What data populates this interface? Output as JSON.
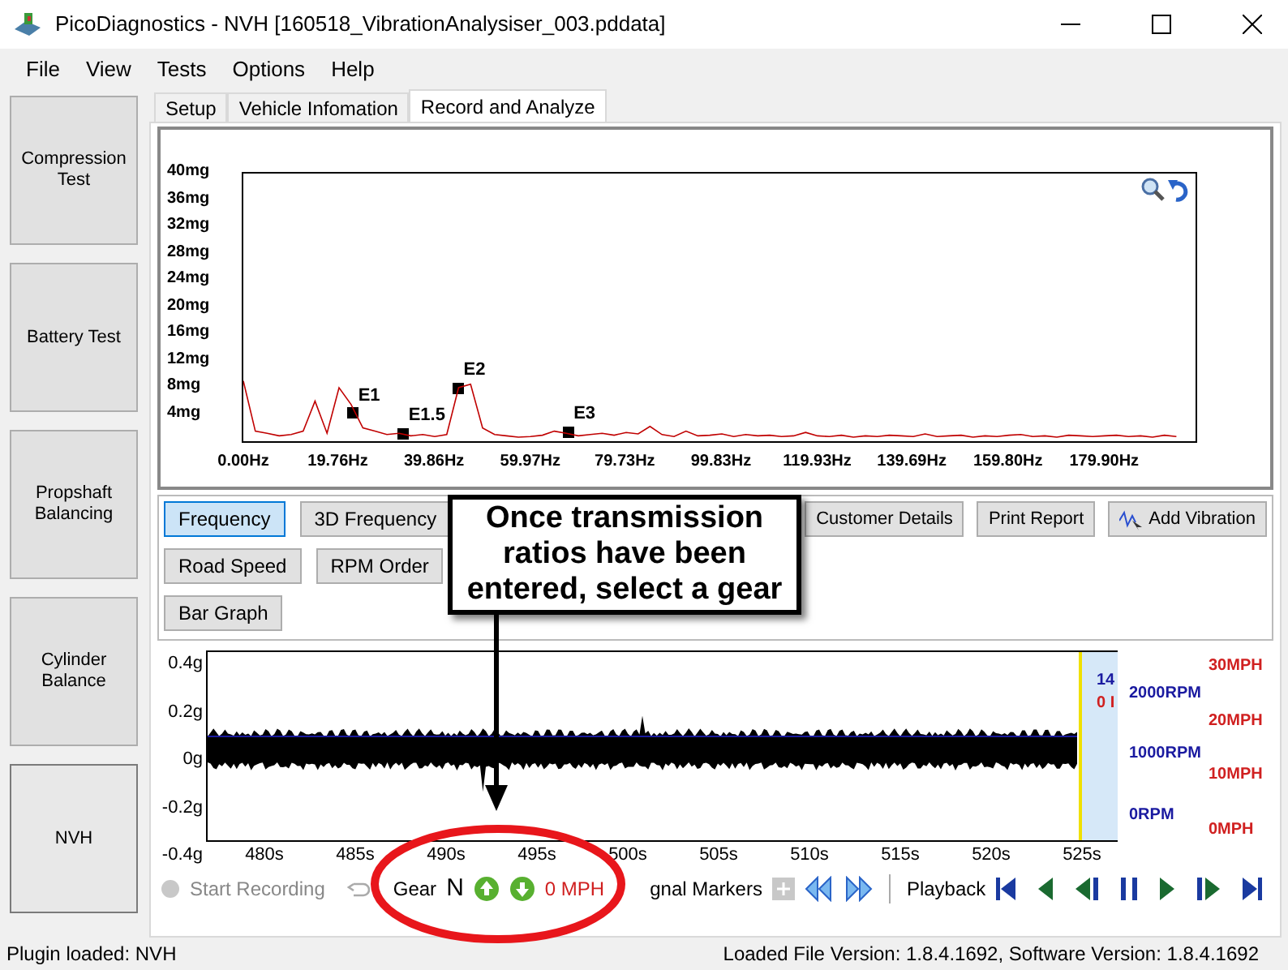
{
  "window": {
    "title": "PicoDiagnostics - NVH [160518_VibrationAnalysiser_003.pddata]"
  },
  "menu": [
    "File",
    "View",
    "Tests",
    "Options",
    "Help"
  ],
  "sidebar": [
    {
      "label": "Compression Test",
      "selected": false
    },
    {
      "label": "Battery Test",
      "selected": false
    },
    {
      "label": "Propshaft Balancing",
      "selected": false
    },
    {
      "label": "Cylinder Balance",
      "selected": false
    },
    {
      "label": "NVH",
      "selected": true
    }
  ],
  "tabs": [
    {
      "label": "Setup",
      "selected": false
    },
    {
      "label": "Vehicle Infomation",
      "selected": false
    },
    {
      "label": "Record and Analyze",
      "selected": true
    }
  ],
  "spectrum": {
    "chart_data": {
      "type": "line",
      "xlim": [
        0,
        199
      ],
      "ylim": [
        0,
        40
      ],
      "yticks": [
        {
          "value": 40,
          "label": "40mg"
        },
        {
          "value": 36,
          "label": "36mg"
        },
        {
          "value": 32,
          "label": "32mg"
        },
        {
          "value": 28,
          "label": "28mg"
        },
        {
          "value": 24,
          "label": "24mg"
        },
        {
          "value": 20,
          "label": "20mg"
        },
        {
          "value": 16,
          "label": "16mg"
        },
        {
          "value": 12,
          "label": "12mg"
        },
        {
          "value": 8,
          "label": "8mg"
        },
        {
          "value": 4,
          "label": "4mg"
        }
      ],
      "xticks": [
        {
          "value": 0,
          "label": "0.00Hz"
        },
        {
          "value": 19.76,
          "label": "19.76Hz"
        },
        {
          "value": 39.86,
          "label": "39.86Hz"
        },
        {
          "value": 59.97,
          "label": "59.97Hz"
        },
        {
          "value": 79.73,
          "label": "79.73Hz"
        },
        {
          "value": 99.83,
          "label": "99.83Hz"
        },
        {
          "value": 119.93,
          "label": "119.93Hz"
        },
        {
          "value": 139.69,
          "label": "139.69Hz"
        },
        {
          "value": 159.8,
          "label": "159.80Hz"
        },
        {
          "value": 179.9,
          "label": "179.90Hz"
        }
      ],
      "x": [
        0,
        2.5,
        5,
        7.5,
        10,
        12.5,
        15,
        17.5,
        20,
        22.5,
        25,
        27.5,
        30,
        32.5,
        35,
        37.5,
        40,
        42.5,
        45,
        47.5,
        50,
        52.5,
        55,
        57.5,
        60,
        62.5,
        65,
        67.5,
        70,
        72.5,
        75,
        77.5,
        80,
        82.5,
        85,
        87.5,
        90,
        92.5,
        95,
        97.5,
        100,
        102.5,
        105,
        107.5,
        110,
        112.5,
        115,
        117.5,
        120,
        122.5,
        125,
        127.5,
        130,
        132.5,
        135,
        137.5,
        140,
        142.5,
        145,
        147.5,
        150,
        152.5,
        155,
        157.5,
        160,
        162.5,
        165,
        167.5,
        170,
        172.5,
        175,
        177.5,
        180,
        182.5,
        185,
        187.5,
        190,
        192.5,
        195
      ],
      "series": [
        {
          "color": "#c00000",
          "values": [
            9,
            1.5,
            1.2,
            0.8,
            1,
            1.5,
            6,
            1.2,
            8,
            5.5,
            2,
            1.5,
            1,
            1.2,
            0.8,
            1,
            0.7,
            1,
            8,
            8.5,
            2,
            1,
            0.8,
            0.6,
            0.7,
            0.9,
            1.5,
            1.2,
            0.8,
            1,
            1.2,
            0.9,
            1.3,
            1.1,
            2.2,
            1,
            0.7,
            1.5,
            0.8,
            0.9,
            1.1,
            0.7,
            1,
            0.8,
            0.9,
            0.7,
            0.8,
            1.3,
            0.8,
            0.7,
            0.9,
            0.6,
            0.8,
            0.7,
            0.9,
            0.8,
            0.7,
            1.1,
            0.7,
            0.8,
            0.9,
            0.6,
            0.8,
            0.7,
            0.9,
            1,
            0.7,
            0.8,
            0.6,
            0.9,
            0.8,
            0.7,
            0.8,
            0.9,
            0.7,
            0.8,
            0.6,
            0.9,
            0.7
          ]
        }
      ],
      "annotations": [
        {
          "x": 23,
          "y": 4.2,
          "text": "E1"
        },
        {
          "x": 33.5,
          "y": 1.2,
          "text": "E1.5"
        },
        {
          "x": 45,
          "y": 8,
          "text": "E2"
        },
        {
          "x": 68,
          "y": 1.4,
          "text": "E3"
        }
      ]
    }
  },
  "view_buttons": [
    {
      "label": "Frequency",
      "selected": true
    },
    {
      "label": "3D Frequency",
      "selected": false
    },
    {
      "label": "Road Speed",
      "selected": false
    },
    {
      "label": "RPM Order",
      "selected": false
    },
    {
      "label": "Bar Graph",
      "selected": false
    }
  ],
  "action_buttons": [
    {
      "label": "Customer Details"
    },
    {
      "label": "Print Report"
    },
    {
      "label": "Add Vibration"
    }
  ],
  "time_plot": {
    "y_labels": [
      "0.4g",
      "0.2g",
      "0g",
      "-0.2g",
      "-0.4g"
    ],
    "x_labels": [
      "480s",
      "485s",
      "490s",
      "495s",
      "500s",
      "505s",
      "510s",
      "515s",
      "520s",
      "525s"
    ],
    "cursor_texts": [
      "14",
      "0 I"
    ],
    "rpm_labels": [
      "2000RPM",
      "1000RPM",
      "0RPM"
    ],
    "mph_labels": [
      "30MPH",
      "20MPH",
      "10MPH",
      "0MPH"
    ]
  },
  "toolbar": {
    "record": "Start Recording",
    "gear_label": "Gear",
    "gear": "N",
    "speed": "0 MPH",
    "markers": "gnal Markers",
    "playback": "Playback"
  },
  "callout": "Once transmission ratios have been entered, select a gear",
  "status_bar": {
    "left": "Plugin loaded: NVH",
    "right": "Loaded File Version: 1.8.4.1692,  Software Version: 1.8.4.1692"
  }
}
